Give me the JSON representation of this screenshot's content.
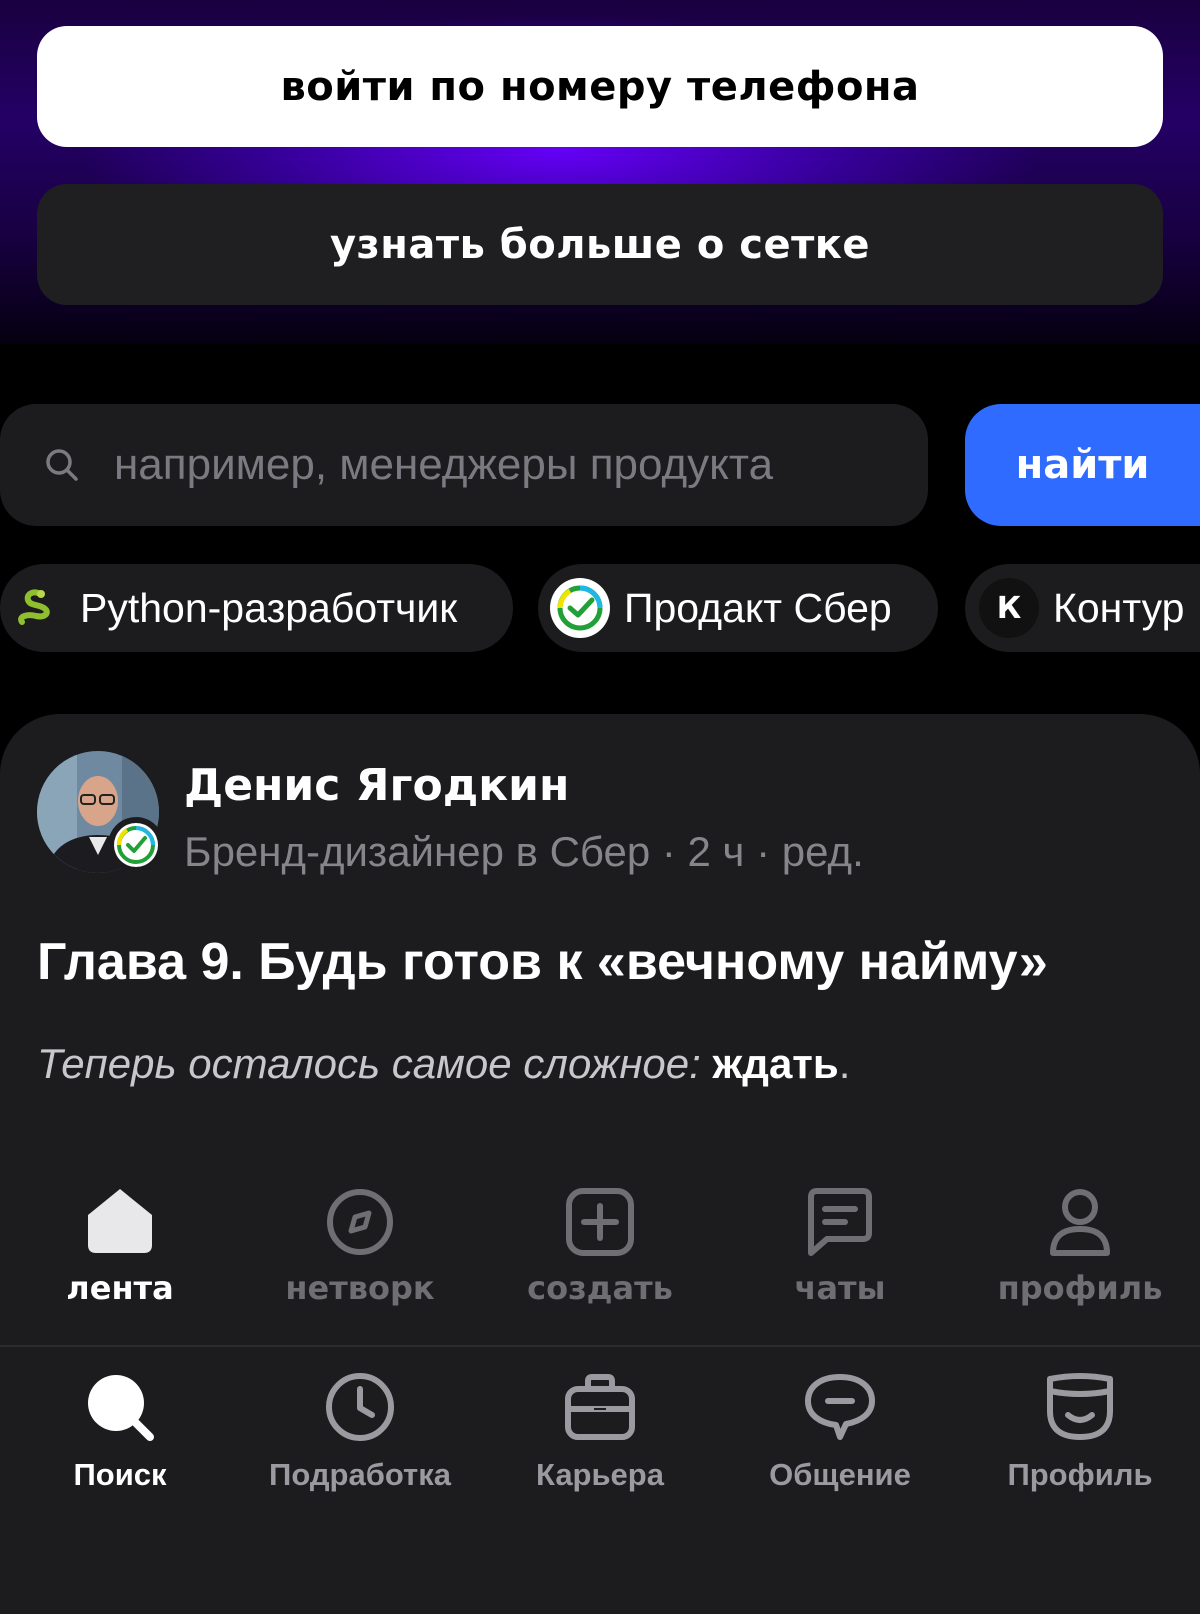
{
  "hero": {
    "login_button": "войти по номеру телефона",
    "learn_more_button": "узнать больше о сетке"
  },
  "search": {
    "placeholder": "например, менеджеры продукта",
    "find_button": "найти"
  },
  "chips": [
    {
      "label": "Python-разработчик",
      "icon": "snake-icon"
    },
    {
      "label": "Продакт Сбер",
      "icon": "sber-logo-icon"
    },
    {
      "label": "Контур",
      "icon": "kontur-logo-icon",
      "icon_letter": "К"
    }
  ],
  "post": {
    "author_name": "Денис Ягодкин",
    "author_meta": "Бренд-дизайнер в Сбер · 2 ч · ред.",
    "title": "Глава 9. Будь готов к «вечному найму»",
    "text_italic": "Теперь осталось самое сложное: ",
    "text_bold": "ждать",
    "text_end": "."
  },
  "app_nav": [
    {
      "label": "лента",
      "icon": "home-icon",
      "active": true
    },
    {
      "label": "нетворк",
      "icon": "compass-icon",
      "active": false
    },
    {
      "label": "создать",
      "icon": "plus-square-icon",
      "active": false
    },
    {
      "label": "чаты",
      "icon": "chat-icon",
      "active": false
    },
    {
      "label": "профиль",
      "icon": "person-icon",
      "active": false
    }
  ],
  "host_nav": [
    {
      "label": "Поиск",
      "icon": "search-icon",
      "active": true
    },
    {
      "label": "Подработка",
      "icon": "clock-icon",
      "active": false
    },
    {
      "label": "Карьера",
      "icon": "briefcase-icon",
      "active": false
    },
    {
      "label": "Общение",
      "icon": "speech-bubble-icon",
      "active": false
    },
    {
      "label": "Профиль",
      "icon": "face-icon",
      "active": false
    }
  ],
  "colors": {
    "accent_blue": "#2f6bff",
    "hero_purple": "#6800ff",
    "card_bg": "#1c1c1e"
  }
}
